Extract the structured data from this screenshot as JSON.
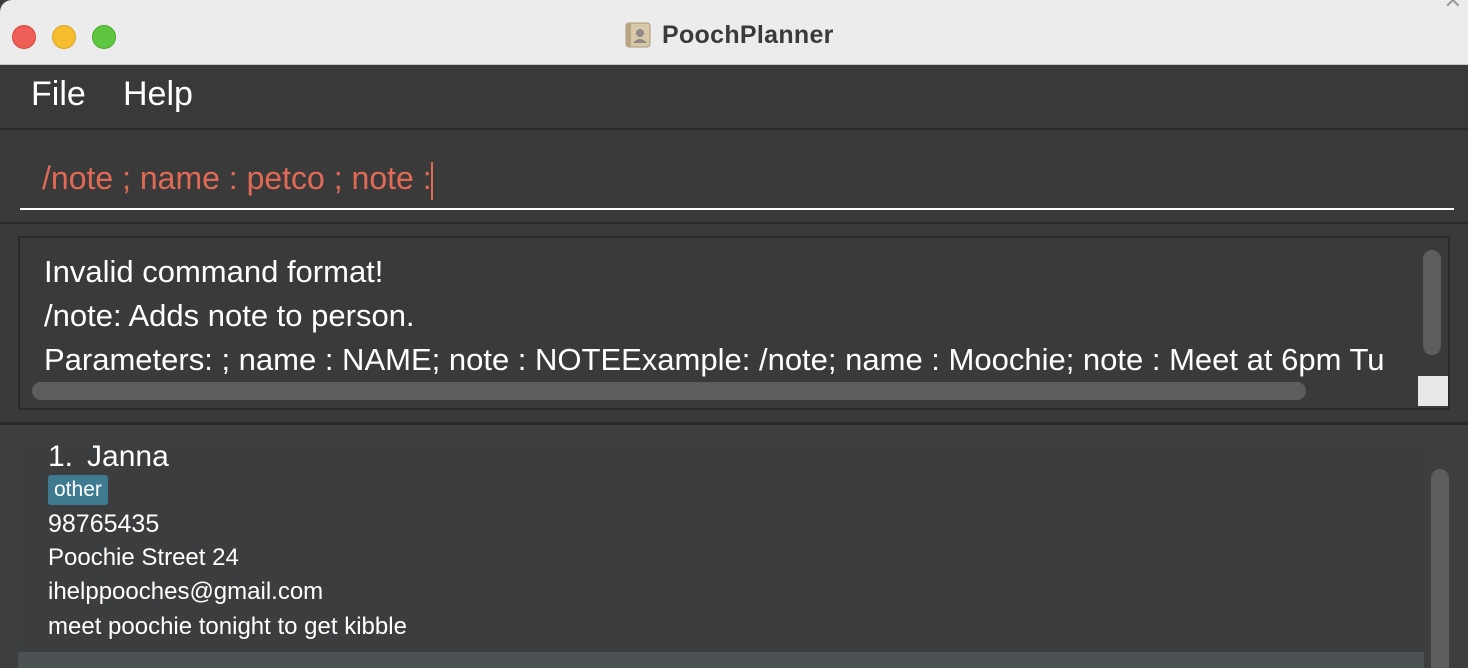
{
  "window": {
    "title": "PoochPlanner",
    "corner_glyph": "✕"
  },
  "menu": {
    "file": "File",
    "help": "Help"
  },
  "command_box": {
    "value": "/note ; name : petco ; note :"
  },
  "result_display": {
    "lines": [
      "Invalid command format!",
      "/note: Adds note to person.",
      "Parameters: ; name : NAME; note : NOTEExample: /note; name :  Moochie; note : Meet at 6pm Tu"
    ]
  },
  "person_list": {
    "items": [
      {
        "index": "1.",
        "name": "Janna",
        "tag": "other",
        "phone": "98765435",
        "address": "Poochie Street 24",
        "email": "ihelppooches@gmail.com",
        "note": "meet poochie tonight to get kibble"
      }
    ]
  },
  "colors": {
    "command_text": "#e06a55",
    "tag_background": "#3e7b91",
    "panel_background": "#3c3d3f"
  },
  "icons": {
    "app": "address-book-icon"
  }
}
